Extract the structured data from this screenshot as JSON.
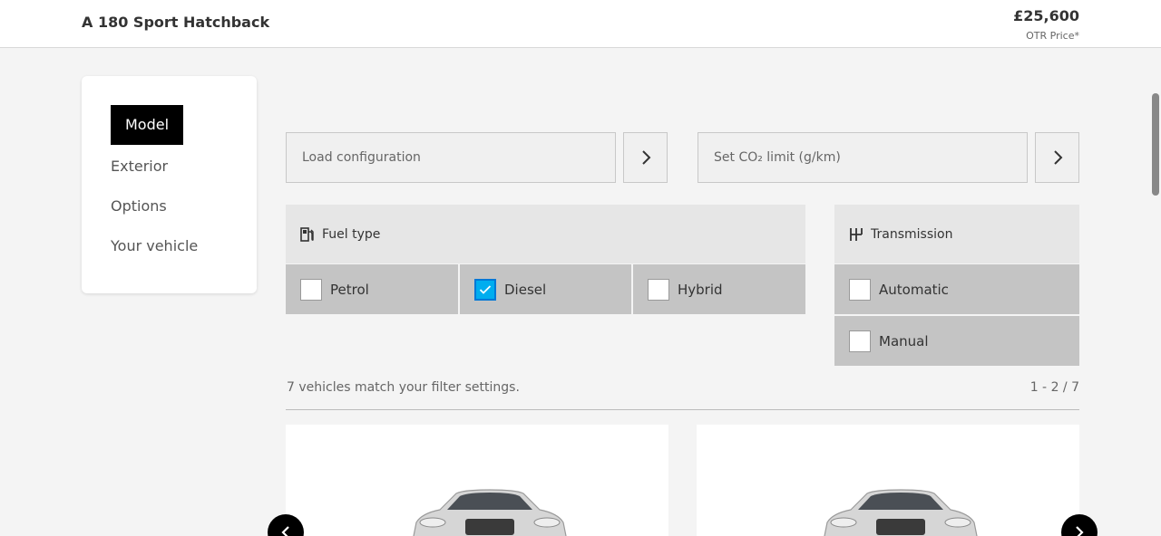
{
  "header": {
    "title": "A 180 Sport Hatchback",
    "price": "£25,600",
    "price_label": "OTR Price*"
  },
  "nav": {
    "items": [
      {
        "label": "Model",
        "active": true
      },
      {
        "label": "Exterior",
        "active": false
      },
      {
        "label": "Options",
        "active": false
      },
      {
        "label": "Your vehicle",
        "active": false
      }
    ]
  },
  "fields": {
    "load_config_placeholder": "Load configuration",
    "co2_placeholder": "Set CO₂ limit (g/km)"
  },
  "fuel": {
    "label": "Fuel type",
    "options": [
      {
        "label": "Petrol",
        "checked": false
      },
      {
        "label": "Diesel",
        "checked": true
      },
      {
        "label": "Hybrid",
        "checked": false
      }
    ]
  },
  "transmission": {
    "label": "Transmission",
    "options": [
      {
        "label": "Automatic",
        "checked": false
      },
      {
        "label": "Manual",
        "checked": false
      }
    ]
  },
  "results": {
    "count_text": "7 vehicles match your filter settings.",
    "paging": "1 - 2 / 7"
  },
  "colors": {
    "checkbox_checked": "#00adef",
    "nav_active_bg": "#000000"
  }
}
